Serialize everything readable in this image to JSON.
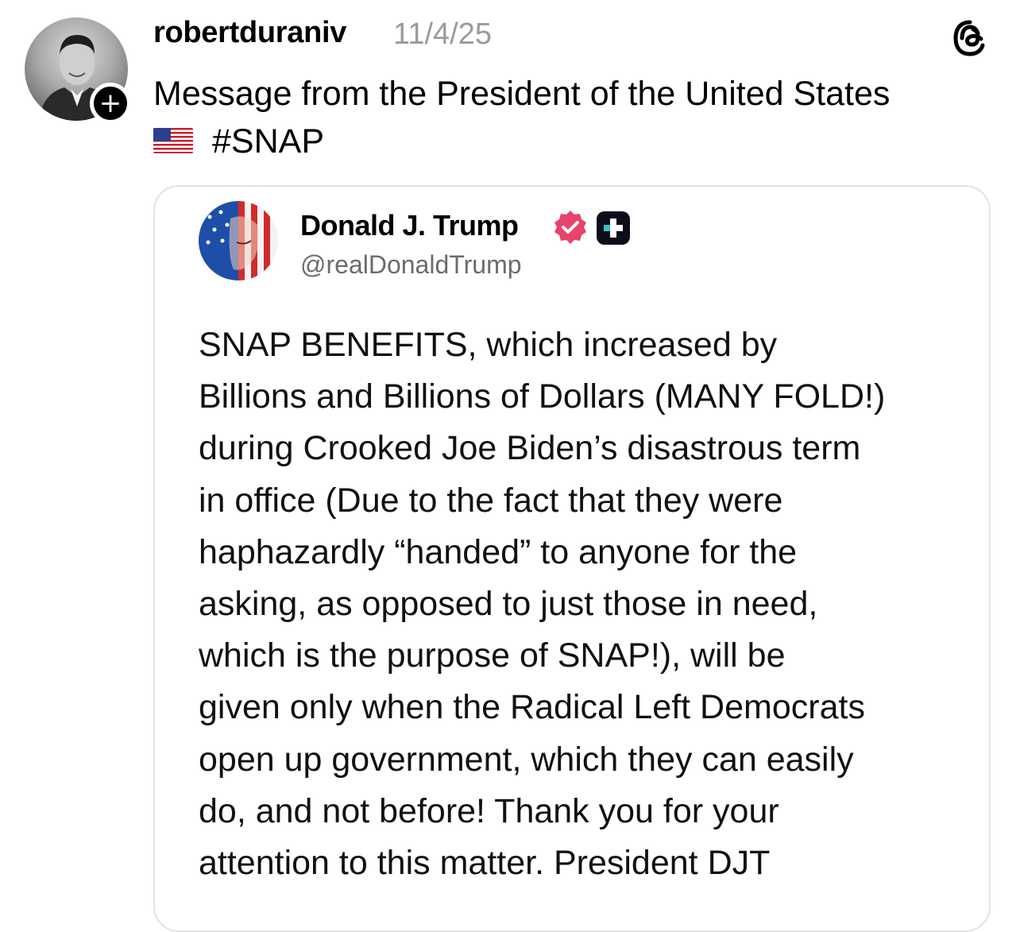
{
  "post": {
    "username": "robertduraniv",
    "timestamp": "11/4/25",
    "caption_line1": "Message from the President of the United States",
    "hashtag": "#SNAP",
    "icons": {
      "avatar": "profile-photo",
      "follow": "plus-icon",
      "app_logo": "threads-logo-icon",
      "flag": "us-flag-icon"
    }
  },
  "quoted": {
    "name": "Donald J. Trump",
    "handle": "@realDonaldTrump",
    "body": "SNAP BENEFITS, which increased by\nBillions and Billions of Dollars (MANY FOLD!)\nduring Crooked Joe Biden’s disastrous term\nin office (Due to the fact that they were\nhaphazardly “handed” to anyone for the\nasking, as opposed to just those in need,\nwhich is the purpose of SNAP!), will be\ngiven only when the Radical Left Democrats\nopen up government, which they can easily\ndo, and not before! Thank you for your\nattention to this matter. President DJT",
    "colors": {
      "verified": "#e8436b",
      "plus_badge": "#0d0d1a"
    }
  }
}
